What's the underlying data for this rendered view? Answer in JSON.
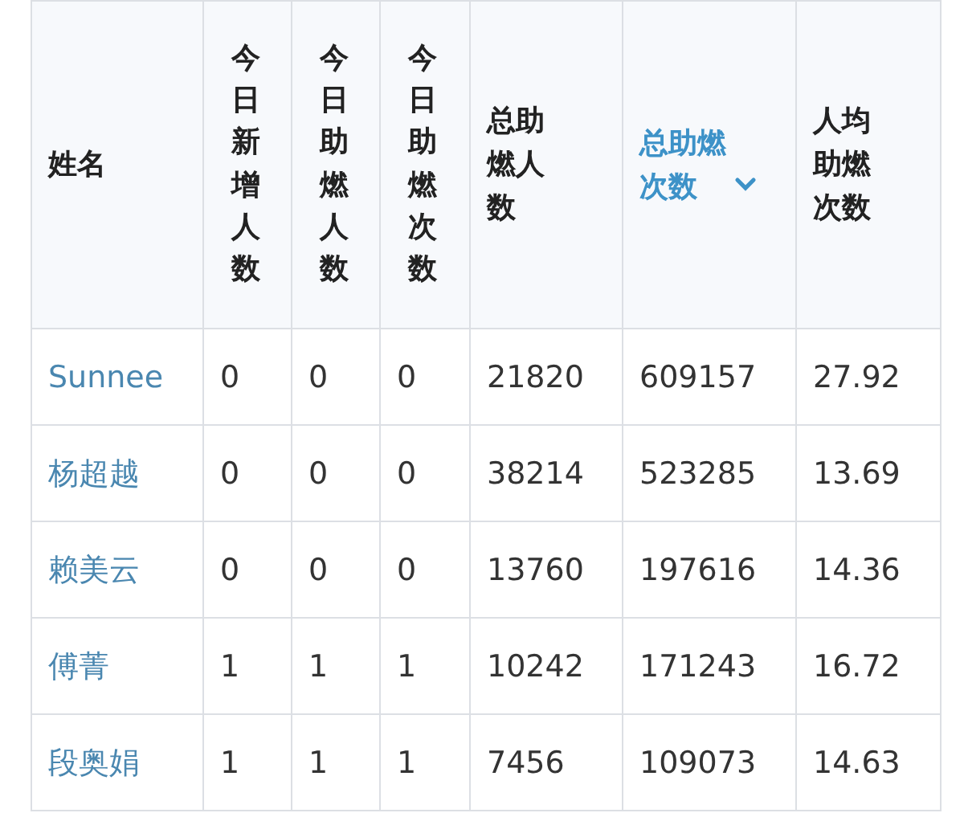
{
  "table": {
    "columns": [
      {
        "label": "姓名",
        "sorted": false
      },
      {
        "label": "今日新增人数",
        "sorted": false
      },
      {
        "label": "今日助燃人数",
        "sorted": false
      },
      {
        "label": "今日助燃次数",
        "sorted": false
      },
      {
        "label": "总助燃人数",
        "sorted": false
      },
      {
        "label": "总助燃次数",
        "sorted": true
      },
      {
        "label": "人均助燃次数",
        "sorted": false
      }
    ],
    "rows": [
      [
        "Sunnee",
        "0",
        "0",
        "0",
        "21820",
        "609157",
        "27.92"
      ],
      [
        "杨超越",
        "0",
        "0",
        "0",
        "38214",
        "523285",
        "13.69"
      ],
      [
        "赖美云",
        "0",
        "0",
        "0",
        "13760",
        "197616",
        "14.36"
      ],
      [
        "傅菁",
        "1",
        "1",
        "1",
        "10242",
        "171243",
        "16.72"
      ],
      [
        "段奥娟",
        "1",
        "1",
        "1",
        "7456",
        "109073",
        "14.63"
      ]
    ]
  }
}
